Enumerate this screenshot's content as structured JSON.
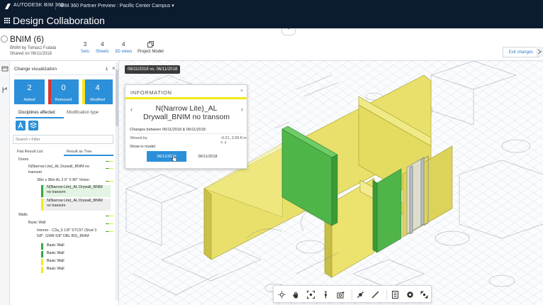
{
  "topbar": {
    "brand": "AUTODESK  BIM 360",
    "project": "BIM 360 Partner Preview : Pacific Center Campus ▾",
    "module_title": "Design Collaboration"
  },
  "header": {
    "title": "BNIM (6)",
    "by": "BNIM by Tomasz Fudala",
    "shared": "Shared on 06/11/2018",
    "stats": [
      {
        "num": "3",
        "label": "Sets"
      },
      {
        "num": "4",
        "label": "Sheets"
      },
      {
        "num": "4",
        "label": "3D views"
      }
    ],
    "project_model": "Project Model",
    "exit_label": "Exit changes"
  },
  "panel": {
    "title": "Change visualization",
    "cards": [
      {
        "num": "2",
        "label": "Added",
        "bar": "#3aa346"
      },
      {
        "num": "0",
        "label": "Removed",
        "bar": "#d9342b"
      },
      {
        "num": "4",
        "label": "Modified",
        "bar": "#f2e81e"
      }
    ],
    "tabs": [
      "Disciplines affected",
      "Modification type"
    ],
    "search_placeholder": "Search • Filter",
    "tabs2": [
      "Flat Result List",
      "Result as Tree"
    ],
    "tree": {
      "doors": "Doors",
      "door_group": "N(Narrow Lite)_AL Drywall_BNIM no",
      "door_group_2": "transom",
      "vision": "36in x 96in AL 2.5\" X 80\" Vision",
      "chip_a1": "N(Narrow Lite)_AL Drywall_BNIM",
      "chip_a2": "no transom",
      "chip_b1": "N(Narrow Lite)_AL Drywall_BNIM",
      "chip_b2": "no transom",
      "walls": "Walls",
      "basic_wall": "Basic Wall",
      "interior_1": "Interior - C3a_6 1/8\" STC57 (Stud 3",
      "interior_2": "5/8\", GWB 5/8\" DBL BS)_BNIM",
      "basic_items": [
        "Basic Wall",
        "Basic Wall",
        "Basic Wall",
        "Basic Wall"
      ]
    }
  },
  "viewport": {
    "compare_label": "06/11/2018 vs. 06/11/2018"
  },
  "info": {
    "heading": "INFORMATION",
    "name_1": "N(Narrow Lite)_AL",
    "name_2": "Drywall_BNIM no transom",
    "changes": "Changes between 06/11/2018 & 06/11/2018",
    "moved_label": "Moved by",
    "moved_value": "-0.21, 2.99 ft in x, y",
    "show_label": "Show in model",
    "btn_a": "06/11/2018",
    "btn_b": "06/11/2018"
  },
  "colors": {
    "accent": "#2b90d9",
    "added": "#3aa346",
    "removed": "#d9342b",
    "modified": "#f2e81e",
    "topbar": "#0d1b2f"
  },
  "icons": {
    "toolbar": [
      "orbit-icon",
      "pan-icon",
      "fit-icon",
      "walk-icon",
      "camera-icon",
      "explode-icon",
      "measure-icon",
      "section-icon",
      "settings-icon",
      "fullscreen-icon"
    ]
  }
}
